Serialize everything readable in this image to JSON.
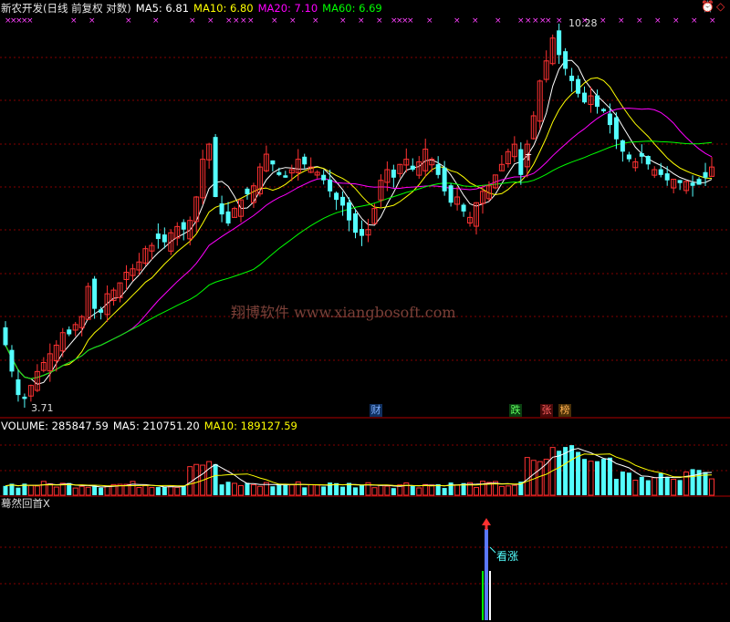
{
  "colors": {
    "bg": "#000000",
    "up": "#ff3232",
    "down": "#54ffff",
    "ma5": "#ffffff",
    "ma10": "#ffff00",
    "ma20": "#ff00ff",
    "ma60": "#00ff00",
    "grid": "#b00000",
    "text": "#dcdcdc",
    "vol_label": "#ffffff"
  },
  "main_panel": {
    "title": "新农开发(日线 前复权 对数)",
    "ma5": "MA5: 6.81",
    "ma10": "MA10: 6.80",
    "ma20": "MA20: 7.10",
    "ma60": "MA60: 6.69",
    "high_label": "10.28",
    "low_label": "3.71",
    "watermark": "翔博软件 www.xiangbosoft.com",
    "event_labels": [
      "财",
      "跌",
      "张",
      "榜"
    ],
    "t_marker": "T",
    "corner_icon_1": "alarm-clock-icon",
    "corner_icon_2": "diamond-icon"
  },
  "volume_panel": {
    "label": "VOLUME: 285847.59",
    "ma5": "MA5: 210751.20",
    "ma10": "MA10: 189127.59"
  },
  "indicator_panel": {
    "name": "蓦然回首X",
    "signal_text": "看涨"
  },
  "chart_data": {
    "type": "candlestick",
    "title": "新农开发(日线 前复权 对数)",
    "ylim": [
      3.6,
      10.5
    ],
    "y_scale": "log",
    "high_marker": 10.28,
    "low_marker": 3.71,
    "close": [
      4.35,
      4.05,
      3.8,
      3.76,
      3.9,
      4.05,
      4.15,
      4.25,
      4.35,
      4.5,
      4.48,
      4.6,
      4.7,
      5.1,
      4.8,
      4.75,
      5.0,
      5.05,
      5.15,
      5.3,
      5.35,
      5.45,
      5.65,
      5.7,
      5.8,
      5.75,
      5.9,
      6.0,
      5.95,
      6.1,
      6.5,
      7.2,
      7.5,
      6.5,
      6.2,
      6.05,
      6.3,
      6.45,
      6.55,
      6.7,
      7.05,
      7.3,
      7.1,
      6.9,
      6.85,
      7.0,
      7.2,
      7.1,
      7.05,
      6.95,
      6.8,
      6.6,
      6.45,
      6.35,
      6.1,
      5.9,
      5.85,
      5.95,
      6.3,
      6.8,
      7.0,
      6.85,
      7.1,
      7.2,
      7.0,
      7.15,
      7.4,
      7.2,
      6.9,
      6.6,
      6.4,
      6.5,
      6.25,
      6.15,
      6.4,
      6.6,
      6.7,
      6.9,
      7.1,
      7.35,
      7.5,
      6.9,
      7.5,
      8.1,
      8.9,
      9.4,
      10.0,
      9.55,
      9.2,
      8.9,
      8.6,
      8.4,
      8.55,
      8.3,
      8.2,
      7.9,
      7.6,
      7.35,
      7.2,
      7.15,
      7.25,
      7.1,
      7.0,
      6.9,
      6.8,
      6.82,
      6.75,
      6.78,
      6.7,
      6.72,
      6.85,
      7.05
    ],
    "ma60_visible_from": 64,
    "volume": {
      "label": "VOLUME",
      "last": 285847.59,
      "ma5": 210751.2,
      "ma10": 189127.59
    }
  }
}
